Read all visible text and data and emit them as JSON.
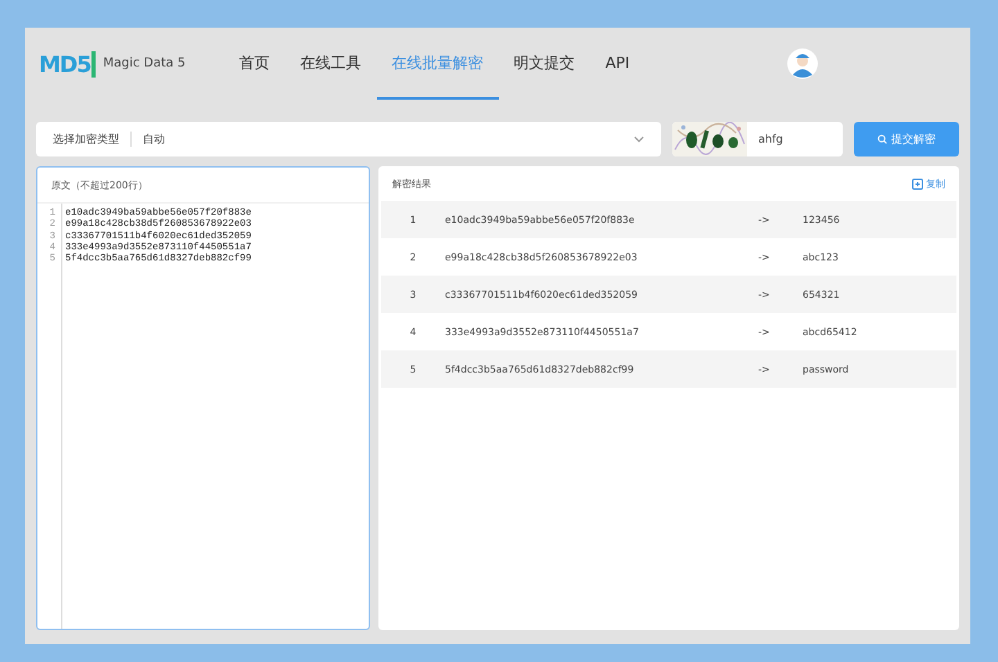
{
  "brand": {
    "logo": "MD5",
    "name": "Magic Data 5"
  },
  "nav": [
    {
      "label": "首页",
      "selected": false
    },
    {
      "label": "在线工具",
      "selected": false
    },
    {
      "label": "在线批量解密",
      "selected": true
    },
    {
      "label": "明文提交",
      "selected": false
    },
    {
      "label": "API",
      "selected": false
    }
  ],
  "toolbar": {
    "type_label": "选择加密类型",
    "type_value": "自动",
    "captcha_value": "ahfg",
    "submit": "提交解密"
  },
  "input_panel": {
    "title": "原文（不超过200行）",
    "lines": [
      {
        "number": "1",
        "text": "e10adc3949ba59abbe56e057f20f883e"
      },
      {
        "number": "2",
        "text": "e99a18c428cb38d5f260853678922e03"
      },
      {
        "number": "3",
        "text": "c33367701511b4f6020ec61ded352059"
      },
      {
        "number": "4",
        "text": "333e4993a9d3552e873110f4450551a7"
      },
      {
        "number": "5",
        "text": "5f4dcc3b5aa765d61d8327deb882cf99"
      }
    ]
  },
  "result_panel": {
    "title": "解密结果",
    "copy": "复制",
    "rows": [
      {
        "index": "1",
        "hash": "e10adc3949ba59abbe56e057f20f883e",
        "arrow": "->",
        "plain": "123456"
      },
      {
        "index": "2",
        "hash": "e99a18c428cb38d5f260853678922e03",
        "arrow": "->",
        "plain": "abc123"
      },
      {
        "index": "3",
        "hash": "c33367701511b4f6020ec61ded352059",
        "arrow": "->",
        "plain": "654321"
      },
      {
        "index": "4",
        "hash": "333e4993a9d3552e873110f4450551a7",
        "arrow": "->",
        "plain": "abcd65412"
      },
      {
        "index": "5",
        "hash": "5f4dcc3b5aa765d61d8327deb882cf99",
        "arrow": "->",
        "plain": "password"
      }
    ]
  }
}
